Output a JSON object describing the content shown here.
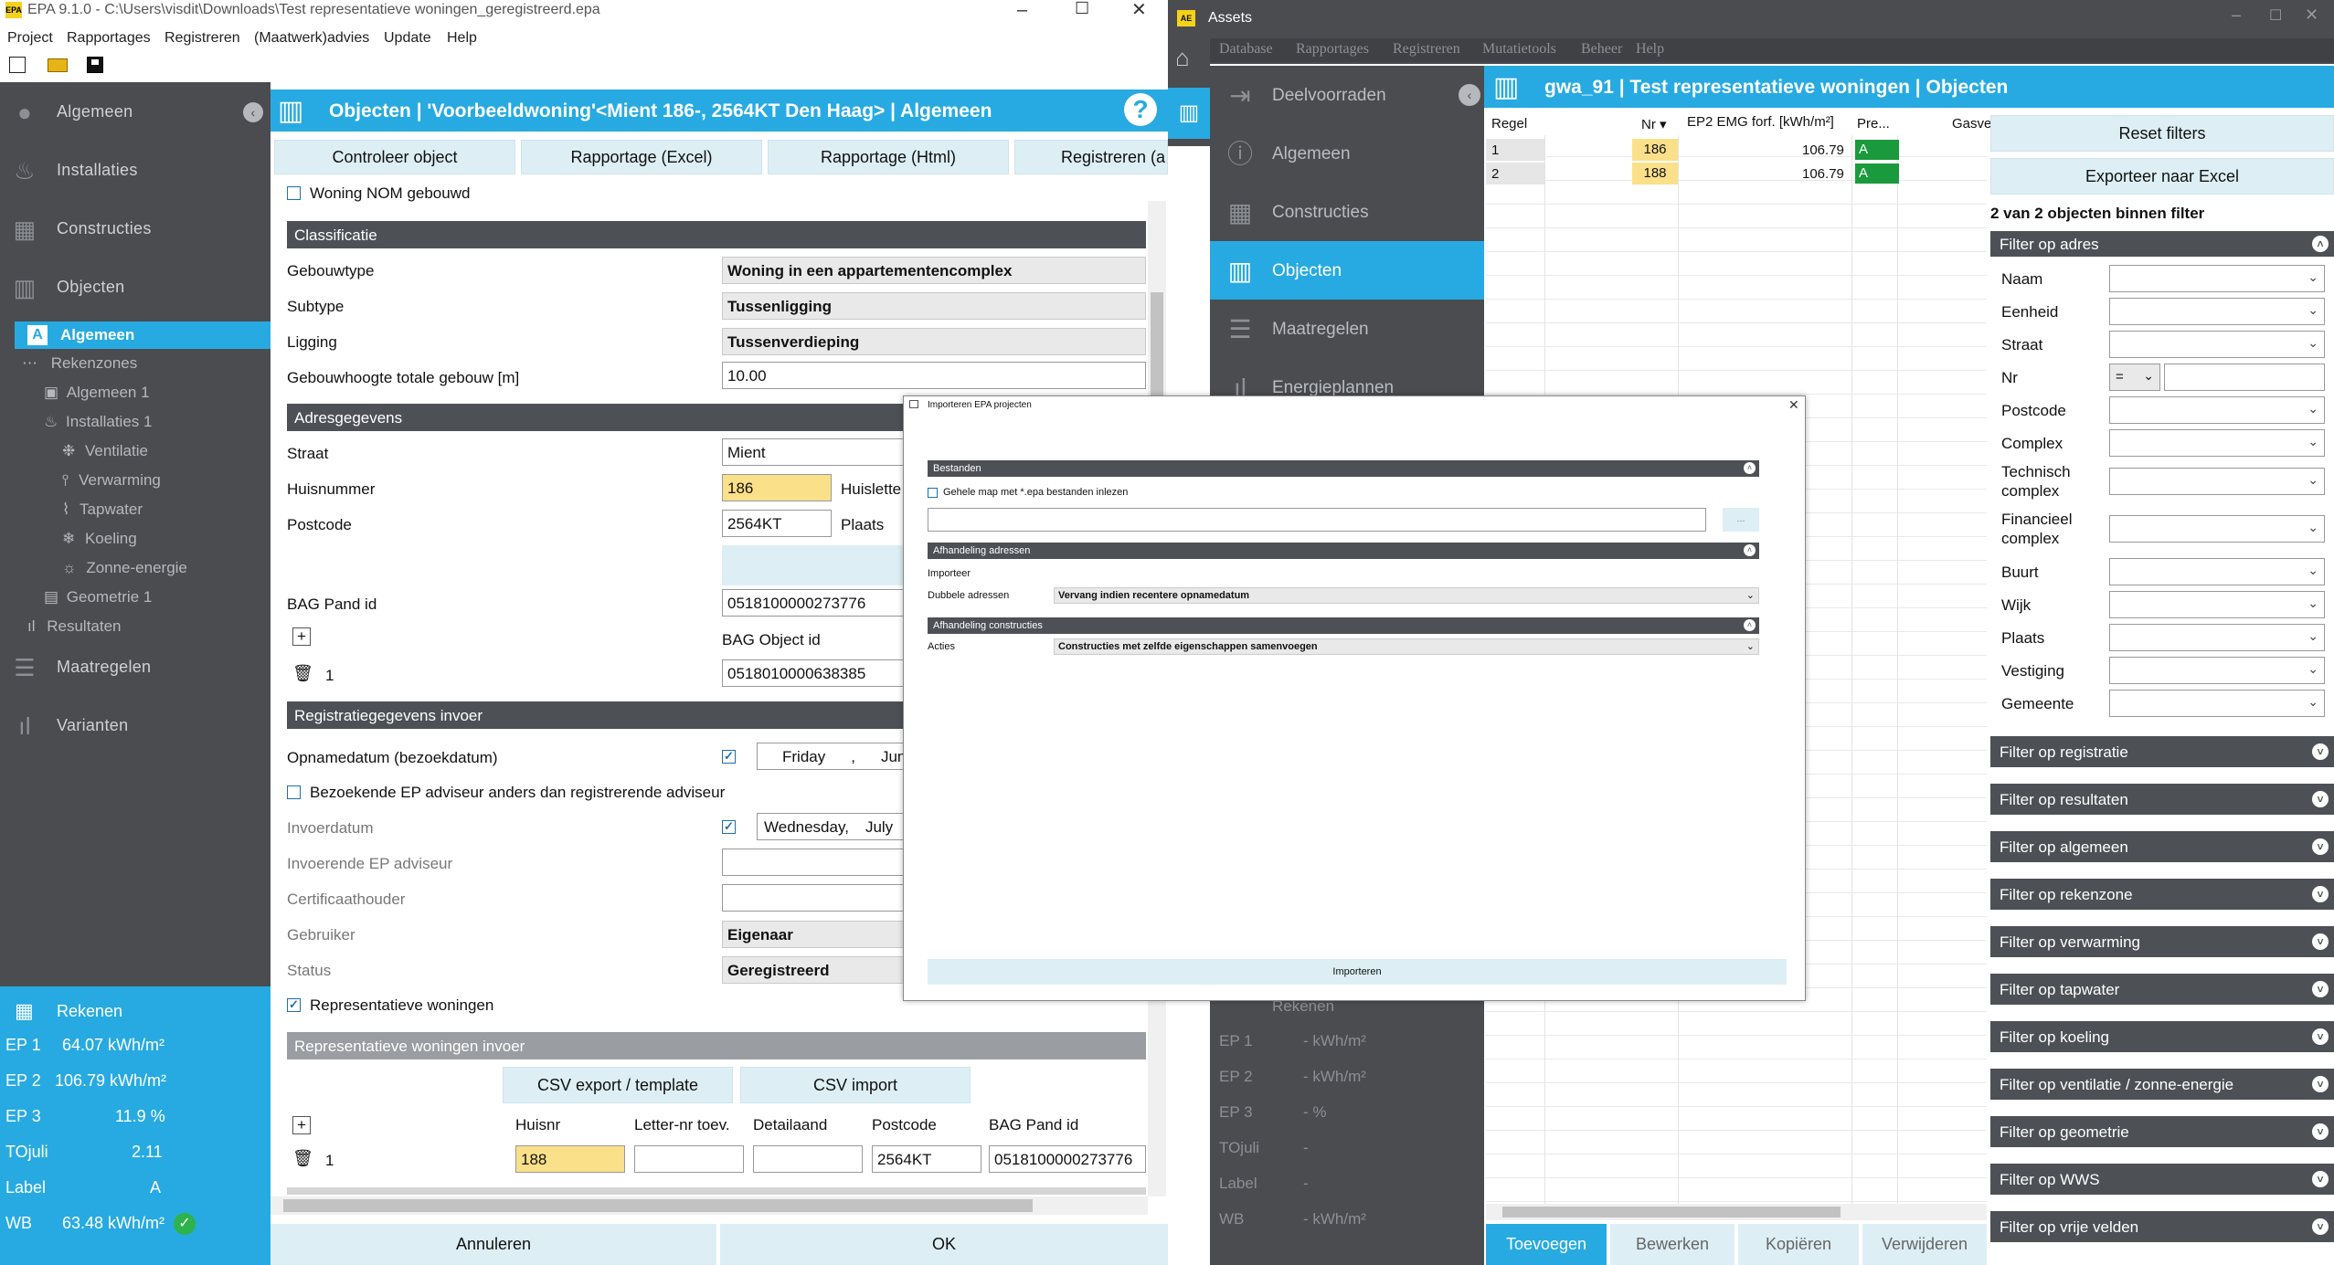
{
  "left_window": {
    "title": "EPA 9.1.0 - C:\\Users\\visdit\\Downloads\\Test representatieve woningen_geregistreerd.epa",
    "logo": "EPA",
    "menu": [
      "Project",
      "Rapportages",
      "Registreren",
      "(Maatwerk)advies",
      "Update",
      "Help"
    ],
    "toolbar_icons": [
      "new-file-icon",
      "open-folder-icon",
      "save-icon"
    ],
    "sidebar": {
      "main": [
        "Algemeen",
        "Installaties",
        "Constructies",
        "Objecten"
      ],
      "sub": [
        "Algemeen",
        "Rekenzones",
        "Algemeen 1",
        "Installaties 1",
        "Ventilatie",
        "Verwarming",
        "Tapwater",
        "Koeling",
        "Zonne-energie",
        "Geometrie 1",
        "Resultaten"
      ],
      "bottom": [
        "Maatregelen",
        "Varianten"
      ],
      "sub_letter": "A"
    },
    "stats": {
      "title": "Rekenen",
      "rows": [
        {
          "label": "EP 1",
          "value": "64.07 kWh/m²"
        },
        {
          "label": "EP 2",
          "value": "106.79 kWh/m²"
        },
        {
          "label": "EP 3",
          "value": "11.9 %"
        },
        {
          "label": "TOjuli",
          "value": "2.11"
        },
        {
          "label": "Label",
          "value": "A"
        },
        {
          "label": "WB",
          "value": "63.48 kWh/m²"
        }
      ]
    },
    "header": {
      "title": "Objecten | 'Voorbeeldwoning'<Mient 186-, 2564KT Den Haag> | Algemeen",
      "help": "?"
    },
    "tabs": [
      "Controleer object",
      "Rapportage (Excel)",
      "Rapportage (Html)",
      "Registreren (a"
    ],
    "nom_label": "Woning NOM gebouwd",
    "classificatie": {
      "title": "Classificatie",
      "gebouwtype_label": "Gebouwtype",
      "gebouwtype": "Woning in een appartementencomplex",
      "subtype_label": "Subtype",
      "subtype": "Tussenligging",
      "ligging_label": "Ligging",
      "ligging": "Tussenverdieping",
      "hoogte_label": "Gebouwhoogte totale gebouw [m]",
      "hoogte": "10.00"
    },
    "adres": {
      "title": "Adresgegevens",
      "straat_label": "Straat",
      "straat": "Mient",
      "huisnr_label": "Huisnummer",
      "huisnr": "186",
      "huisletter_label": "Huislette",
      "postcode_label": "Postcode",
      "postcode": "2564KT",
      "plaats_label": "Plaats",
      "bag_pand_label": "BAG Pand id",
      "bag_pand": "0518100000273776",
      "bag_object_label": "BAG Object id",
      "bag_object": "0518010000638385",
      "row_index": "1"
    },
    "registratie": {
      "title": "Registratiegegevens invoer",
      "opname_label": "Opnamedatum (bezoekdatum)",
      "opname_day": "Friday",
      "opname_sep": ",",
      "opname_month": "June",
      "bezoekende_label": "Bezoekende EP adviseur anders dan registrerende adviseur",
      "invoer_label": "Invoerdatum",
      "invoer_day": "Wednesday,",
      "invoer_month": "July",
      "invoerende_label": "Invoerende  EP adviseur",
      "cert_label": "Certificaathouder",
      "gebruiker_label": "Gebruiker",
      "gebruiker": "Eigenaar",
      "status_label": "Status",
      "status": "Geregistreerd",
      "repr_label": "Representatieve woningen"
    },
    "repr": {
      "title": "Representatieve woningen invoer",
      "csv_export": "CSV export / template",
      "csv_import": "CSV import",
      "cols": [
        "Huisnr",
        "Letter-nr toev.",
        "Detailaand",
        "Postcode",
        "BAG Pand id"
      ],
      "row": {
        "index": "1",
        "huisnr": "188",
        "letter": "",
        "detail": "",
        "postcode": "2564KT",
        "bag": "0518100000273776"
      }
    },
    "footer": {
      "cancel": "Annuleren",
      "ok": "OK"
    }
  },
  "right_window": {
    "title": "Assets",
    "logo": "AE",
    "menu": [
      "Database",
      "Rapportages",
      "Registreren",
      "Mutatietools",
      "Beheer",
      "Help"
    ],
    "sidebar": [
      "Deelvoorraden",
      "Algemeen",
      "Constructies",
      "Objecten",
      "Maatregelen",
      "Energieplannen"
    ],
    "stats": {
      "title": "Rekenen",
      "rows": [
        {
          "label": "EP 1",
          "value": "-  kWh/m²"
        },
        {
          "label": "EP 2",
          "value": "-  kWh/m²"
        },
        {
          "label": "EP 3",
          "value": "-  %"
        },
        {
          "label": "TOjuli",
          "value": "-"
        },
        {
          "label": "Label",
          "value": "-"
        },
        {
          "label": "WB",
          "value": "-  kWh/m²"
        }
      ]
    },
    "header": "gwa_91 | Test representatieve woningen | Objecten",
    "grid": {
      "cols": [
        "Regel",
        "Nr ▾",
        "EP2 EMG forf. [kWh/m²]",
        "Pre...",
        "Gasve"
      ],
      "rows": [
        {
          "regel": "1",
          "nr": "186",
          "ep2": "106.79",
          "pre": "A"
        },
        {
          "regel": "2",
          "nr": "188",
          "ep2": "106.79",
          "pre": "A"
        }
      ]
    },
    "filters": {
      "reset": "Reset filters",
      "export": "Exporteer naar Excel",
      "count": "2 van 2 objecten binnen filter",
      "adres_title": "Filter op adres",
      "adres_fields": [
        "Naam",
        "Eenheid",
        "Straat",
        "Nr",
        "Postcode",
        "Complex",
        "Technisch complex",
        "Financieel complex",
        "Buurt",
        "Wijk",
        "Plaats",
        "Vestiging",
        "Gemeente"
      ],
      "nr_operator": "=",
      "sections": [
        "Filter op registratie",
        "Filter op resultaten",
        "Filter op algemeen",
        "Filter op rekenzone",
        "Filter op verwarming",
        "Filter op tapwater",
        "Filter op koeling",
        "Filter op ventilatie / zonne-energie",
        "Filter op geometrie",
        "Filter op WWS",
        "Filter op vrije velden"
      ]
    },
    "bottom_buttons": [
      "Toevoegen",
      "Bewerken",
      "Kopiëren",
      "Verwijderen"
    ]
  },
  "dialog": {
    "title": "Importeren EPA projecten",
    "bestanden": "Bestanden",
    "gehele_map": "Gehele map met *.epa bestanden inlezen",
    "browse": "...",
    "afhandeling_adressen": "Afhandeling adressen",
    "importeer": "Importeer",
    "dubbele_label": "Dubbele adressen",
    "dubbele_value": "Vervang indien recentere opnamedatum",
    "afhandeling_constructies": "Afhandeling constructies",
    "acties_label": "Acties",
    "acties_value": "Constructies met zelfde eigenschappen samenvoegen",
    "import_button": "Importeren"
  },
  "colors": {
    "accent": "#27aae1",
    "dark": "#4a4c50",
    "bar": "#4d5156",
    "highlight": "#fbe08a",
    "label_green": "#1a9a3c"
  }
}
